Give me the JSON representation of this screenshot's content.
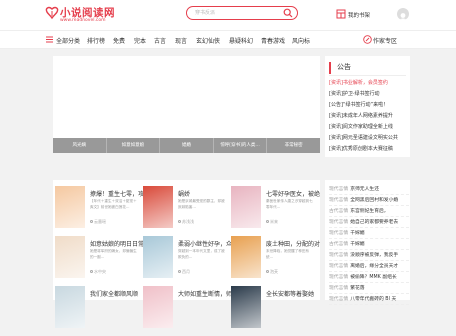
{
  "header": {
    "logo_text": "小说阅读网",
    "logo_sub": "www.readnovel.com",
    "search_placeholder": "穿书反派",
    "shelf_label": "我的书架"
  },
  "nav": {
    "items": [
      "全部分类",
      "排行榜",
      "免费",
      "完本",
      "古言",
      "现言",
      "玄幻仙侠",
      "悬疑科幻",
      "青春游戏",
      "风向标"
    ],
    "author_zone": "作家专区"
  },
  "tabs": [
    "风光嫡",
    "如意如意娘",
    "娼婚",
    "惊呼[穿书]的人类…",
    "非常秘密"
  ],
  "notice": {
    "title": "公告",
    "items": [
      {
        "tag": "[资讯]",
        "text": "书业解析，会员签约",
        "highlight": true
      },
      {
        "tag": "[资讯]",
        "text": "护卫·绿书签行动",
        "highlight": false
      },
      {
        "tag": "[公告]",
        "text": "“绿书签行动”来啦！",
        "highlight": false
      },
      {
        "tag": "[资讯]",
        "text": "未成年人网络素养提升",
        "highlight": false
      },
      {
        "tag": "[资讯]",
        "text": "阅文作家助理全新上线",
        "highlight": false
      },
      {
        "tag": "[资讯]",
        "text": "网元圣语建设文明实公共",
        "highlight": false
      },
      {
        "tag": "[资讯]",
        "text": "优秀原创剧本大赛征稿",
        "highlight": false
      }
    ]
  },
  "books": [
    {
      "title": "撩爆！重生七零，攻",
      "desc": "【年代＋重生＋双洁＋甜宠＋爽文】前世她被白莲花…",
      "author": "云墨瑶",
      "color": "#f5c8a0"
    },
    {
      "title": "蜗娇",
      "desc": "她是京城最受宠的郡主，却被庶妹陷害…",
      "author": "苏浅浅",
      "color": "#d94a3a"
    },
    {
      "title": "七零好孕医女，被绝",
      "desc": "秦医世家传人唐之汐穿越到七零年代…",
      "author": "米来",
      "color": "#e8b4c0"
    },
    {
      "title": "如意姑娘的明日日常",
      "desc": "她是将军府的嫡女，却偏偏生的一副…",
      "author": "水中央",
      "color": "#f0dcc8"
    },
    {
      "title": "柔弱小继性好孕，众",
      "desc": "穿越到一本年代文里，成了被欺负的…",
      "author": "西月",
      "color": "#a8c8d8"
    },
    {
      "title": "废土种田，分配的对",
      "desc": "末世降临，她觉醒了种田系统…",
      "author": "泡芙",
      "color": "#e8a050"
    },
    {
      "title": "我们家全都顺风顺",
      "desc": "",
      "author": "",
      "color": "#c8d8e0"
    },
    {
      "title": "大师如重生断情，师",
      "desc": "",
      "author": "",
      "color": "#f0c0c8"
    },
    {
      "title": "全长安都等着娶她",
      "desc": "",
      "author": "",
      "color": "#2a3a4a"
    }
  ],
  "ranks": [
    {
      "cat": "现代言情",
      "title": "京师无人生还"
    },
    {
      "cat": "现代言情",
      "title": "全网黑后回村和发小婚"
    },
    {
      "cat": "古代言情",
      "title": "东宫侧妃生育后，"
    },
    {
      "cat": "现代言情",
      "title": "她自己的家都要养老去"
    },
    {
      "cat": "现代言情",
      "title": "千嫁媚"
    },
    {
      "cat": "古代言情",
      "title": "千嫁媚"
    },
    {
      "cat": "现代言情",
      "title": "没顺序被反弹，我反手"
    },
    {
      "cat": "现代言情",
      "title": "离婚后，缘分全员天才"
    },
    {
      "cat": "现代言情",
      "title": "被偷降？MMK 副组长"
    },
    {
      "cat": "现代言情",
      "title": "繁花落"
    },
    {
      "cat": "现代言情",
      "title": "八零年代搬砖的 Bl 天"
    }
  ]
}
